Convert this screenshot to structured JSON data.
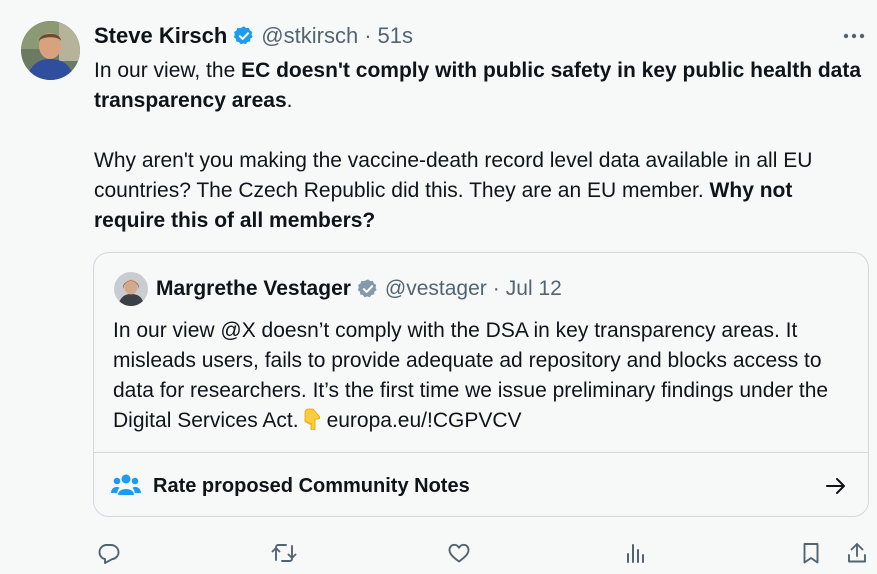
{
  "tweet": {
    "author_name": "Steve Kirsch",
    "handle": "@stkirsch",
    "separator": "·",
    "time": "51s",
    "para1": {
      "pre": "In our view, the ",
      "bold": "EC doesn't comply with public safety in key public health data transparency areas",
      "post": "."
    },
    "para2": {
      "text": "Why aren't you making the vaccine-death record level data available in all EU countries? The Czech Republic did this. They are an EU member. ",
      "bold": "Why not require this of all members?"
    }
  },
  "quote": {
    "author_name": "Margrethe Vestager",
    "handle": "@vestager",
    "separator": "·",
    "date": "Jul 12",
    "text": "In our view @X doesn’t comply with the DSA in key transparency areas. It misleads users, fails to provide adequate ad repository and blocks access to data for researchers. It’s the first time we issue preliminary findings under the Digital Services Act.",
    "link": "europa.eu/!CGPVCV",
    "community_notes_label": "Rate proposed Community Notes"
  },
  "icons": {
    "verified": "verified-badge-icon",
    "more": "more-icon",
    "pointing": "pointing-down-emoji-icon",
    "community_notes": "community-notes-icon",
    "arrow": "arrow-right-icon",
    "reply": "reply-icon",
    "retweet": "retweet-icon",
    "like": "like-icon",
    "views": "views-icon",
    "bookmark": "bookmark-icon",
    "share": "share-icon"
  },
  "colors": {
    "accent": "#1d9bf0",
    "gov_badge": "#829aab",
    "text": "#0f1419",
    "muted": "#536471"
  }
}
